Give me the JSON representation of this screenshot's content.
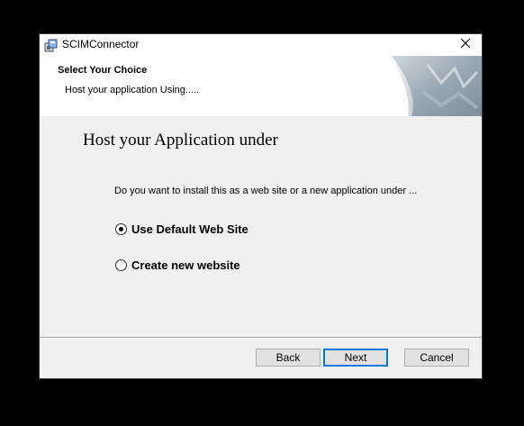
{
  "window": {
    "title": "SCIMConnector",
    "app_icon": "installer-icon",
    "close_icon": "close-icon"
  },
  "banner": {
    "title": "Select Your Choice",
    "subtitle": "Host your application Using.....",
    "art": "page-curl-graphic"
  },
  "main": {
    "heading": "Host your Application under",
    "question": "Do you want to install this as a web site or a new application under ...",
    "options": [
      {
        "label": "Use Default Web Site",
        "selected": true
      },
      {
        "label": "Create new website",
        "selected": false
      }
    ]
  },
  "buttons": {
    "back": "Back",
    "next": "Next",
    "cancel": "Cancel"
  },
  "colors": {
    "focus_border": "#0078d7",
    "dialog_bg": "#f0f0f0"
  }
}
